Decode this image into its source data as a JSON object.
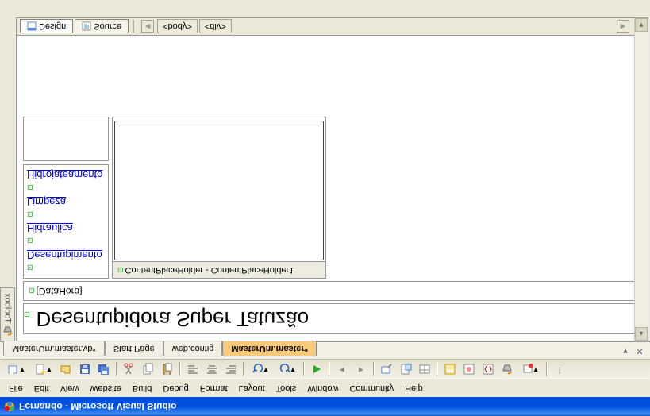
{
  "window": {
    "title": "Fernando - Microsoft Visual Studio"
  },
  "menu": [
    "File",
    "Edit",
    "View",
    "Website",
    "Build",
    "Debug",
    "Format",
    "Layout",
    "Tools",
    "Window",
    "Community",
    "Help"
  ],
  "tabs": [
    {
      "label": "MasterUm.master.vb*",
      "active": false
    },
    {
      "label": "Start Page",
      "active": false
    },
    {
      "label": "web.config",
      "active": false
    },
    {
      "label": "MasterUm.master*",
      "active": true
    }
  ],
  "toolbox_label": "Toolbox",
  "page": {
    "title": "Desentupidora Super Tatuzão",
    "datahora": "[DataHora]",
    "links": [
      "Desentupimento",
      "Hidraulica",
      "Limpeza",
      "Hidrojateamento"
    ],
    "placeholder_label": "ContentPlaceHolder - ContentPlaceHolder1"
  },
  "views": {
    "design": "Design",
    "source": "Source",
    "breadcrumb": [
      "<body>",
      "<div>"
    ]
  }
}
